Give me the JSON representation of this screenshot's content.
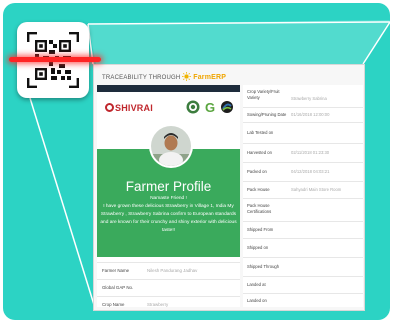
{
  "header": {
    "traceability_text": "TRACEABILITY THROUGH",
    "farm_logo": "FarmERP"
  },
  "brand": {
    "name": "SHIVRAI"
  },
  "badges": [
    {
      "icon": "certification-seal-icon",
      "color": "#3c7d3e"
    },
    {
      "icon": "globalgap-g-icon",
      "color": "#5aa53f"
    },
    {
      "icon": "fairtrade-icon",
      "color": "#2f6fae"
    }
  ],
  "profile": {
    "title": "Farmer Profile",
    "greeting": "Namaste Friend !",
    "message": "I have grown these delicious Strawberry in Village 1, India My Strawberry , Strawberry Sabrina confirm to European standards and are known for their crunchy and shiny exterior with delicious taste!!"
  },
  "left_rows": [
    {
      "label": "Farmer Name",
      "value": "Nilesh Pandurang Jadhav"
    },
    {
      "label": "Global GAP No.",
      "value": ""
    },
    {
      "label": "Crop Name",
      "value": "Strawberry"
    }
  ],
  "right_rows": [
    {
      "label": "Crop Variety/Fruit Variety",
      "value": "Strawberry Sabrina"
    },
    {
      "label": "Sowing/Pruning Date",
      "value": "01/16/2018 12:00:00"
    },
    {
      "label": "Lab Tested on",
      "value": ""
    },
    {
      "label": "Harvested on",
      "value": "02/11/2018 01:23:30"
    },
    {
      "label": "Packed on",
      "value": "04/12/2018 04:03:21"
    },
    {
      "label": "Pack House",
      "value": "Sahyadri Main Store Room"
    },
    {
      "label": "Pack House Certifications",
      "value": ""
    },
    {
      "label": "Shipped From",
      "value": ""
    },
    {
      "label": "Shipped on",
      "value": ""
    },
    {
      "label": "Shipped Through",
      "value": ""
    },
    {
      "label": "Landed at",
      "value": ""
    },
    {
      "label": "Landed on",
      "value": ""
    }
  ],
  "colors": {
    "teal": "#2cd3c4",
    "green": "#3aaa5c",
    "brand_red": "#c0272d",
    "laser": "#ff2424"
  }
}
